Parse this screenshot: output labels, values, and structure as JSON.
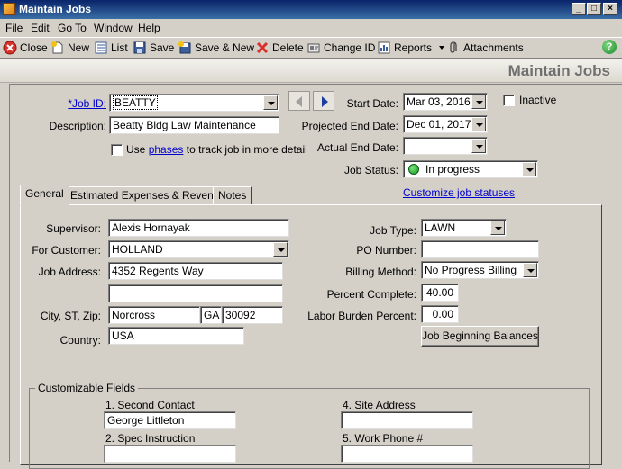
{
  "window": {
    "title": "Maintain Jobs"
  },
  "menu": [
    "File",
    "Edit",
    "Go To",
    "Window",
    "Help"
  ],
  "toolbar": {
    "close": "Close",
    "new": "New",
    "list": "List",
    "save": "Save",
    "save_new": "Save & New",
    "delete": "Delete",
    "change_id": "Change ID",
    "reports": "Reports",
    "attachments": "Attachments",
    "icons": [
      "close-icon",
      "new-icon",
      "list-icon",
      "save-icon",
      "save-new-icon",
      "delete-icon",
      "change-id-icon",
      "reports-icon",
      "attachment-icon",
      "help-icon"
    ]
  },
  "header": {
    "title": "Maintain Jobs"
  },
  "form": {
    "job_id_label": "*Job ID:",
    "job_id_value": "BEATTY",
    "description_label": "Description:",
    "description_value": "Beatty Bldg Law Maintenance",
    "use_phases_prefix": "Use",
    "use_phases_link": "phases",
    "use_phases_suffix": "to track job in more detail",
    "start_date_label": "Start Date:",
    "start_date_value": "Mar 03, 2016",
    "projected_end_label": "Projected End Date:",
    "projected_end_value": "Dec 01, 2017",
    "actual_end_label": "Actual End Date:",
    "actual_end_value": "",
    "job_status_label": "Job Status:",
    "job_status_value": "In progress",
    "inactive_label": "Inactive",
    "customize_link": "Customize job statuses"
  },
  "tabs": [
    "General",
    "Estimated Expenses & Revenue",
    "Notes"
  ],
  "general": {
    "supervisor_label": "Supervisor:",
    "supervisor_value": "Alexis Hornayak",
    "customer_label": "For Customer:",
    "customer_value": "HOLLAND",
    "address_label": "Job Address:",
    "address_line1": "4352 Regents Way",
    "address_line2": "",
    "csz_label": "City, ST, Zip:",
    "city": "Norcross",
    "state": "GA",
    "zip": "30092",
    "country_label": "Country:",
    "country_value": "USA",
    "job_type_label": "Job Type:",
    "job_type_value": "LAWN",
    "po_label": "PO Number:",
    "po_value": "",
    "billing_label": "Billing Method:",
    "billing_value": "No Progress Billing",
    "percent_label": "Percent Complete:",
    "percent_value": "40.00",
    "labor_label": "Labor Burden Percent:",
    "labor_value": "0.00",
    "beginning_balances_button": "Job Beginning Balances"
  },
  "custom_fields": {
    "title": "Customizable Fields",
    "f1_label": "1. Second Contact",
    "f1_value": "George Littleton",
    "f2_label": "2. Spec Instruction",
    "f2_value": "",
    "f4_label": "4. Site Address",
    "f4_value": "",
    "f5_label": "5. Work Phone #",
    "f5_value": ""
  },
  "colors": {
    "title_bar": "#0a246a",
    "link": "#0000cc",
    "status_in_progress": "#0f9a1f"
  }
}
